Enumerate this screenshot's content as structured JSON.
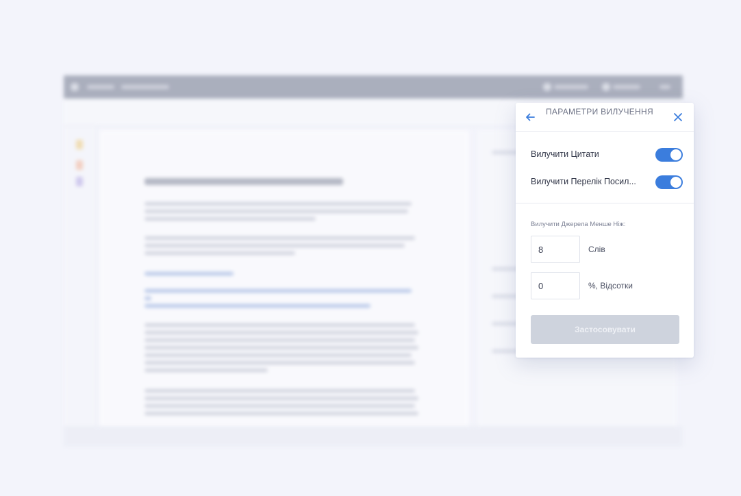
{
  "panel": {
    "title": "ПАРАМЕТРИ ВИЛУЧЕННЯ",
    "back_icon": "arrow-left-icon",
    "close_icon": "close-icon",
    "exclude_quotes": {
      "label": "Вилучити Цитати",
      "enabled": true
    },
    "exclude_references": {
      "label": "Вилучити Перелік Посил...",
      "enabled": true
    },
    "section_label": "Вилучити Джерела Менше Ніж:",
    "words_field": {
      "value": "8",
      "unit": "Слів"
    },
    "percent_field": {
      "value": "0",
      "unit": "%, Відсотки"
    },
    "apply_label": "Застосовувати"
  },
  "colors": {
    "accent": "#3b7ddd",
    "apply_disabled": "#ced3dd"
  }
}
